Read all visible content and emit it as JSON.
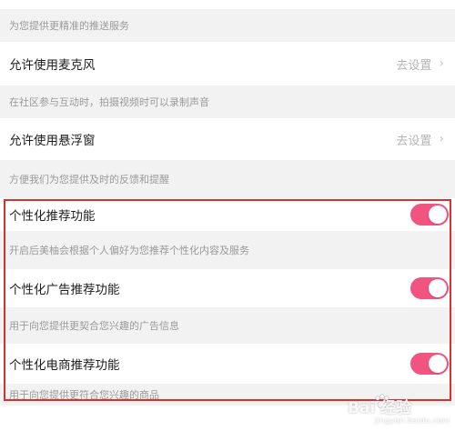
{
  "settings": {
    "push_desc": "为您提供更精准的推送服务",
    "microphone": {
      "title": "允许使用麦克风",
      "action": "去设置",
      "desc": "在社区参与互动时，拍摄视频时可以录制声音"
    },
    "floating_window": {
      "title": "允许使用悬浮窗",
      "action": "去设置",
      "desc": "方便我们为您提供及时的反馈和提醒"
    },
    "personalized_recommend": {
      "title": "个性化推荐功能",
      "enabled": true,
      "desc": "开启后美柚会根据个人偏好为您推荐个性化内容及服务"
    },
    "personalized_ads": {
      "title": "个性化广告推荐功能",
      "enabled": true,
      "desc": "用于向您提供更契合您兴趣的广告信息"
    },
    "personalized_ecommerce": {
      "title": "个性化电商推荐功能",
      "enabled": true,
      "desc": "用于向您提供更符合您兴趣的商品"
    }
  },
  "icons": {
    "chevron": "chevron-right-icon",
    "toggle": "toggle-switch-icon"
  },
  "colors": {
    "toggle_on": "#f25482",
    "highlight_border": "#d93030"
  },
  "watermark": {
    "main": "Bai 经验",
    "sub": "jingyan.baidu.com"
  }
}
